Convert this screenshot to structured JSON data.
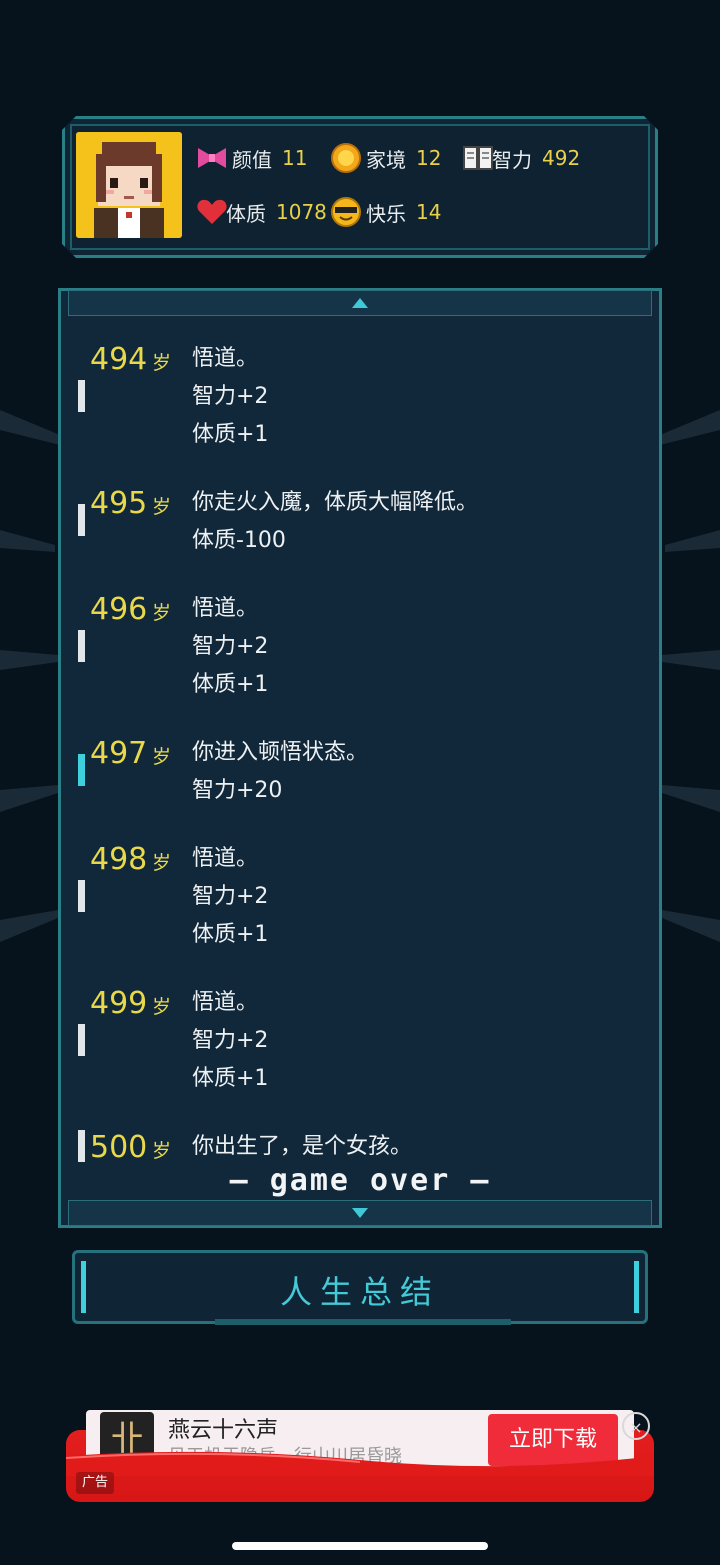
{
  "stats": {
    "looks": {
      "label": "颜值",
      "value": "11"
    },
    "family": {
      "label": "家境",
      "value": "12"
    },
    "intelligence": {
      "label": "智力",
      "value": "492"
    },
    "physique": {
      "label": "体质",
      "value": "1078"
    },
    "happiness": {
      "label": "快乐",
      "value": "14"
    }
  },
  "log": {
    "entries": [
      {
        "age": "494",
        "unit": "岁",
        "lines": [
          "悟道。",
          "智力+2",
          "体质+1"
        ],
        "marker_color": "#e0e6ea"
      },
      {
        "age": "495",
        "unit": "岁",
        "lines": [
          "你走火入魔，体质大幅降低。",
          "体质-100"
        ],
        "marker_color": "#e0e6ea"
      },
      {
        "age": "496",
        "unit": "岁",
        "lines": [
          "悟道。",
          "智力+2",
          "体质+1"
        ],
        "marker_color": "#e0e6ea"
      },
      {
        "age": "497",
        "unit": "岁",
        "lines": [
          "你进入顿悟状态。",
          "智力+20"
        ],
        "marker_color": "#3fd0dd"
      },
      {
        "age": "498",
        "unit": "岁",
        "lines": [
          "悟道。",
          "智力+2",
          "体质+1"
        ],
        "marker_color": "#e0e6ea"
      },
      {
        "age": "499",
        "unit": "岁",
        "lines": [
          "悟道。",
          "智力+2",
          "体质+1"
        ],
        "marker_color": "#e0e6ea"
      },
      {
        "age": "500",
        "unit": "岁",
        "lines": [
          "你出生了，是个女孩。"
        ],
        "marker_color": "#e0e6ea"
      }
    ],
    "game_over": "— game over —"
  },
  "summary_button": {
    "label": "人生总结"
  },
  "ad": {
    "logo_text": "卝",
    "title": "燕云十六声",
    "subtitle": "见天机于隐岳，行山川居昏晓",
    "cta": "立即下载",
    "badge": "广告",
    "close": "×"
  },
  "colors": {
    "accent": "#3fd0dd",
    "age": "#e8d84a",
    "panel": "#11283a"
  }
}
